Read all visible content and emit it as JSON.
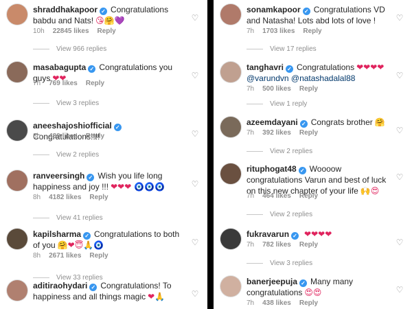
{
  "left": [
    {
      "user": "shraddhakapoor",
      "verified": true,
      "text": "Congratulations babdu and Nats!",
      "emoji": "😘🤗💜",
      "time": "10h",
      "likes": "22845 likes",
      "reply": "Reply",
      "view_replies": "View 966 replies"
    },
    {
      "user": "masabagupta",
      "verified": true,
      "text": "Congratulations you guys",
      "emoji": "❤❤",
      "time": "7h",
      "likes": "769 likes",
      "reply": "Reply",
      "view_replies": "View 3 replies"
    },
    {
      "user": "aneeshajoshiofficial",
      "verified": true,
      "text": "Congratulations!!!!",
      "emoji": "",
      "time": "8h",
      "likes": "489 likes",
      "reply": "Reply",
      "view_replies": "View 2 replies"
    },
    {
      "user": "ranveersingh",
      "verified": true,
      "text": "Wish you life long happiness and joy !!!",
      "emoji": "❤❤❤ 🧿🧿🧿",
      "time": "8h",
      "likes": "4182 likes",
      "reply": "Reply",
      "view_replies": "View 41 replies"
    },
    {
      "user": "kapilsharma",
      "verified": true,
      "text": "Congratulations to both of you",
      "emoji": "🤗❤😇🙏🧿",
      "time": "8h",
      "likes": "2671 likes",
      "reply": "Reply",
      "view_replies": "View 33 replies"
    },
    {
      "user": "aditiraohydari",
      "verified": true,
      "text": "Congratulations! To happiness and all things magic",
      "emoji": "❤🙏",
      "time": "",
      "likes": "",
      "reply": "",
      "view_replies": ""
    }
  ],
  "right": [
    {
      "user": "sonamkapoor",
      "verified": true,
      "text": "Congratulations VD and Natasha! Lots abd lots of love !",
      "emoji": "",
      "time": "7h",
      "likes": "1703 likes",
      "reply": "Reply",
      "view_replies": "View 17 replies"
    },
    {
      "user": "tanghavri",
      "verified": true,
      "text": "Congratulations",
      "emoji": "❤❤❤❤",
      "mentions": "@varundvn @natashadalal88",
      "time": "7h",
      "likes": "500 likes",
      "reply": "Reply",
      "view_replies": "View 1 reply"
    },
    {
      "user": "azeemdayani",
      "verified": true,
      "text": "Congrats brother",
      "emoji": "🤗",
      "time": "7h",
      "likes": "392 likes",
      "reply": "Reply",
      "view_replies": "View 2 replies"
    },
    {
      "user": "rituphogat48",
      "verified": true,
      "text": "Woooow congratulations Varun and best of luck on this new chapter of your life",
      "emoji": "🙌😍",
      "time": "7h",
      "likes": "464 likes",
      "reply": "Reply",
      "view_replies": "View 2 replies"
    },
    {
      "user": "fukravarun",
      "verified": true,
      "text": "",
      "emoji": "❤❤❤❤",
      "time": "7h",
      "likes": "782 likes",
      "reply": "Reply",
      "view_replies": "View 3 replies"
    },
    {
      "user": "banerjeepuja",
      "verified": true,
      "text": "Many many congratulations",
      "emoji": "😍😍",
      "time": "7h",
      "likes": "438 likes",
      "reply": "Reply",
      "view_replies": ""
    }
  ],
  "colors": {
    "verified": "#3897f0",
    "meta": "#8e8e8e",
    "text": "#262626",
    "mention": "#00376b"
  },
  "icons": {
    "heart": "heart-outline-icon",
    "verified": "verified-badge-icon"
  }
}
